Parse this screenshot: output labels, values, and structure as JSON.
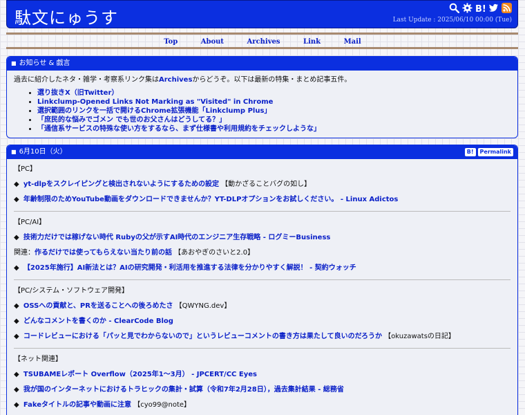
{
  "header": {
    "title": "駄文にゅうす",
    "last_update": "Last Update : 2025/06/10 00:00 (Tue)",
    "icons": [
      "search-icon",
      "gear-icon",
      "hatena-bookmark-icon",
      "twitter-icon",
      "rss-icon"
    ]
  },
  "nav": {
    "items": [
      "Top",
      "About",
      "Archives",
      "Link",
      "Mail"
    ]
  },
  "notice": {
    "heading": "お知らせ & 戯言",
    "intro_before": "過去に紹介したネタ・雑学・考察系リンク集は",
    "intro_link": "Archives",
    "intro_after": "からどうぞ。以下は最新の特集・まとめ記事五件。",
    "links": [
      "選り抜きX（旧Twitter）",
      "Linkclump-Opened Links Not Marking as \"Visited\" in Chrome",
      "選択範囲のリンクを一括で開けるChrome拡張機能「Linkclump Plus」",
      "「庶民的な悩みでゴメン でも世のお父さんはどうしてる？」",
      "「通信系サービスの特殊な使い方をするなら、まず仕様書や利用規約をチェックしような」"
    ]
  },
  "day": {
    "heading": "6月10日（火）",
    "btn_bookmark": "B!",
    "btn_permalink": "Permalink",
    "sections": [
      {
        "category": "【PC】",
        "items": [
          {
            "link": "yt-dlpをスクレイピングと検出されないようにするための設定",
            "note": " 【動かざることバグの如し】",
            "prefix": "◆ "
          },
          {
            "link": "年齢制限のためYouTube動画をダウンロードできませんか？YT-DLPオプションをお試しください。 - Linux Adictos",
            "note": "",
            "prefix": "◆ "
          }
        ]
      },
      {
        "category": "【PC/AI】",
        "items": [
          {
            "link": "技術力だけでは稼げない時代 Rubyの父が示すAI時代のエンジニア生存戦略 - ログミーBusiness",
            "note": "",
            "prefix": "◆ "
          },
          {
            "link": "作るだけでは使ってもらえない当たり前の話",
            "note": " 【あおやぎのさいと2.0】",
            "prefix": "関連："
          },
          {
            "link": "【2025年施行】AI新法とは？AIの研究開発・利活用を推進する法律を分かりやすく解説！ - 契約ウォッチ",
            "note": "",
            "prefix": "◆ "
          }
        ]
      },
      {
        "category": "【PC/システム・ソフトウェア開発】",
        "items": [
          {
            "link": "OSSへの貢献と、PRを送ることへの後ろめたさ",
            "note": " 【QWYNG.dev】",
            "prefix": "◆ "
          },
          {
            "link": "どんなコメントを書くのか - ClearCode Blog",
            "note": "",
            "prefix": "◆ "
          },
          {
            "link": "コードレビューにおける「パッと見でわからないので」というレビューコメントの書き方は果たして良いのだろうか",
            "note": " 【okuzawatsの日記】",
            "prefix": "◆ "
          }
        ]
      },
      {
        "category": "【ネット関連】",
        "items": [
          {
            "link": "TSUBAMEレポート Overflow（2025年1～3月） - JPCERT/CC Eyes",
            "note": "",
            "prefix": "◆ "
          },
          {
            "link": "我が国のインターネットにおけるトラヒックの集計・試算（令和7年2月28日），過去集計結果 - 総務省",
            "note": "",
            "prefix": "◆ "
          },
          {
            "link": "Fakeタイトルの記事や動画に注意",
            "note": " 【cyo99@note】",
            "prefix": "◆ "
          }
        ]
      }
    ]
  }
}
